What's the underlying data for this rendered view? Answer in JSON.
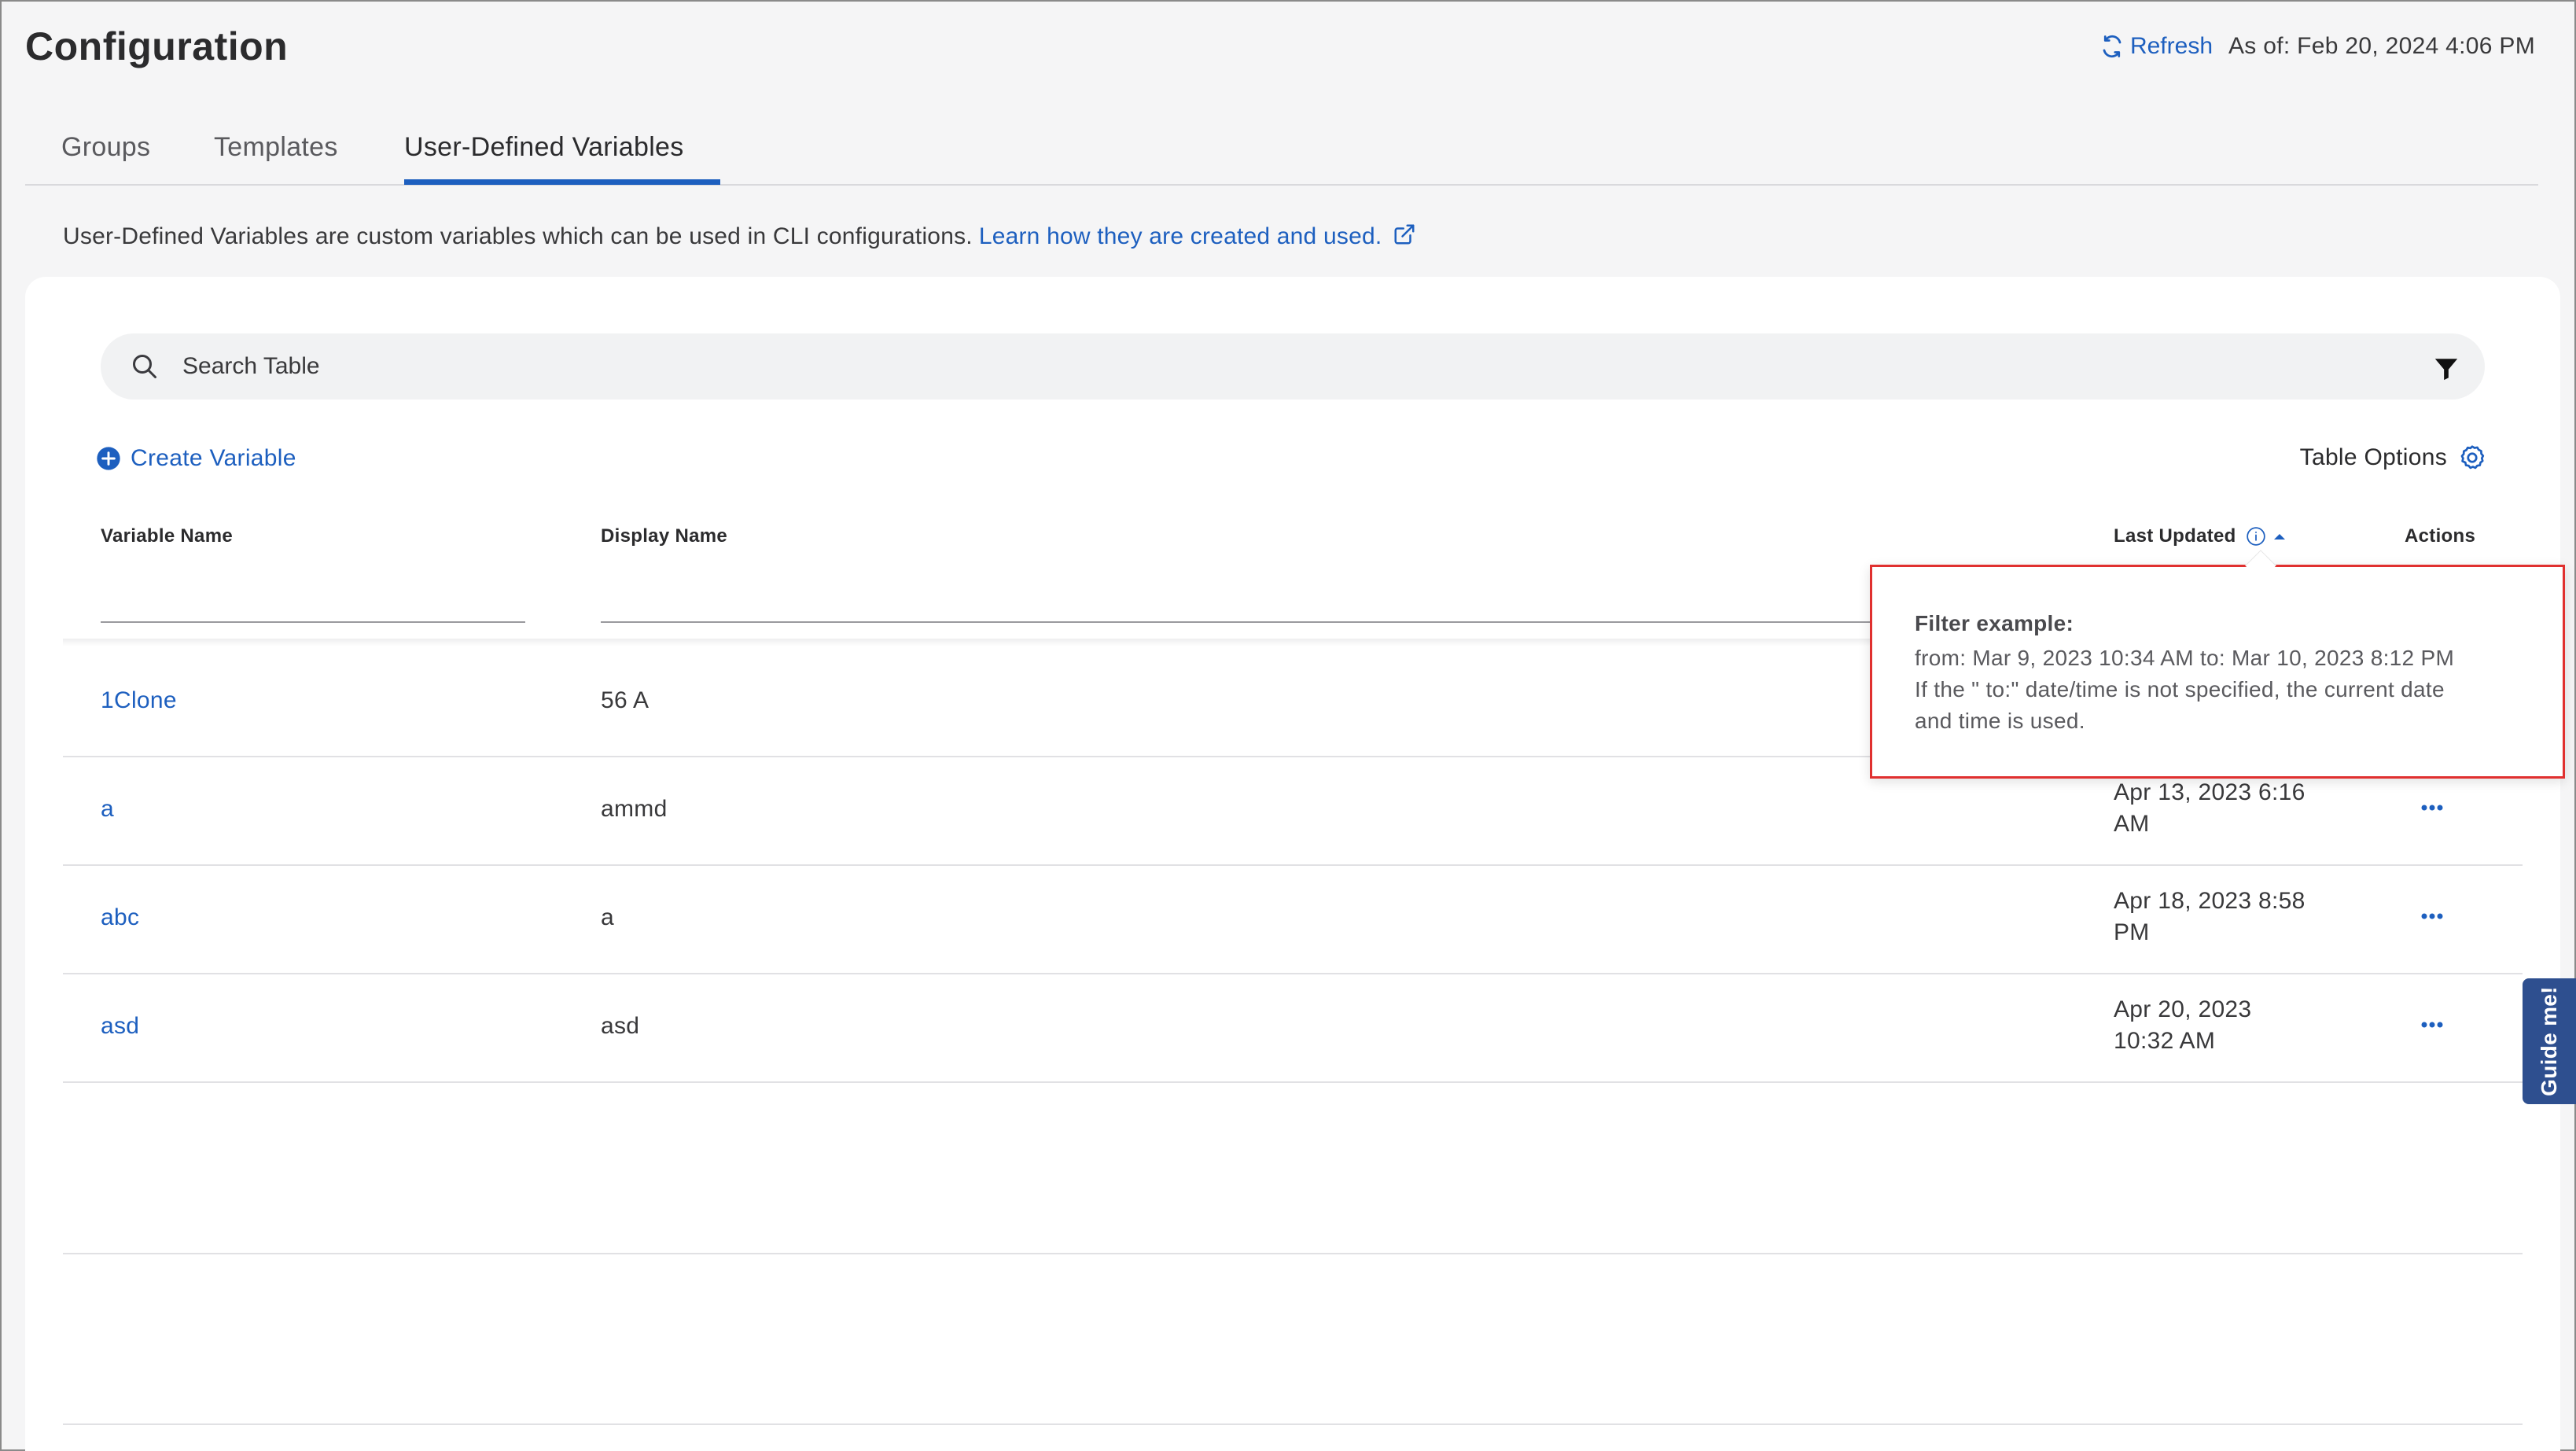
{
  "header": {
    "title": "Configuration",
    "refresh_label": "Refresh",
    "as_of": "As of: Feb 20, 2024 4:06 PM"
  },
  "tabs": [
    {
      "label": "Groups",
      "active": false
    },
    {
      "label": "Templates",
      "active": false
    },
    {
      "label": "User-Defined Variables",
      "active": true
    }
  ],
  "description": {
    "text": "User-Defined Variables are custom variables which can be used in CLI configurations.",
    "link_text": "Learn how they are created and used."
  },
  "search": {
    "placeholder": "Search Table"
  },
  "toolbar": {
    "create_label": "Create Variable",
    "table_options_label": "Table Options"
  },
  "columns": {
    "variable_name": "Variable Name",
    "display_name": "Display Name",
    "last_updated": "Last Updated",
    "actions": "Actions"
  },
  "rows": [
    {
      "variable_name": "1Clone",
      "display_name": "56 A",
      "last_updated_1": "",
      "last_updated_2": ""
    },
    {
      "variable_name": "a",
      "display_name": "ammd",
      "last_updated_1": "Apr 13, 2023 6:16",
      "last_updated_2": "AM"
    },
    {
      "variable_name": "abc",
      "display_name": "a",
      "last_updated_1": "Apr 18, 2023 8:58",
      "last_updated_2": "PM"
    },
    {
      "variable_name": "asd",
      "display_name": "asd",
      "last_updated_1": "Apr 20, 2023",
      "last_updated_2": "10:32 AM"
    }
  ],
  "tooltip": {
    "title": "Filter example:",
    "line1": "from: Mar 9, 2023 10:34 AM to: Mar 10, 2023 8:12 PM",
    "line2": "If the \" to:\" date/time is not specified, the current date",
    "line3": "and time is used."
  },
  "guide": {
    "label": "Guide me!"
  },
  "colors": {
    "accent": "#1d5fbf",
    "highlight_border": "#e0302f",
    "guide_bg": "#2e4f8f"
  }
}
